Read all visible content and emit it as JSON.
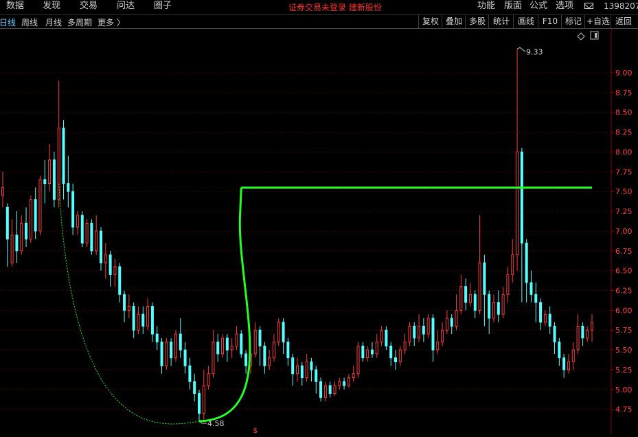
{
  "menu": {
    "items": [
      "数据",
      "发现",
      "交易",
      "问达",
      "圈子"
    ],
    "right_items": [
      "功能",
      "版面",
      "公式",
      "选项"
    ],
    "user_id": "1398207"
  },
  "status_text": "证券交易未登录  建新股份",
  "toolbar": {
    "periods": [
      "日线",
      "周线",
      "月线",
      "多周期",
      "更多 〉"
    ],
    "active_period": "日线",
    "buttons": [
      "复权",
      "叠加",
      "多股",
      "统计",
      "画线",
      "F10",
      "标记",
      "+自选",
      "返回"
    ]
  },
  "colors": {
    "up": "#ff3b3b",
    "down": "#54ffff",
    "grid": "#7a0000",
    "axis_label": "#ff4040",
    "cup_line": "#22ff22"
  },
  "chart_data": {
    "type": "candlestick",
    "ylim": [
      4.6,
      9.45
    ],
    "y_ticks": [
      "4.75",
      "5.00",
      "5.25",
      "5.50",
      "5.75",
      "6.00",
      "6.25",
      "6.50",
      "6.75",
      "7.00",
      "7.25",
      "7.50",
      "7.75",
      "8.00",
      "8.25",
      "8.50",
      "8.75",
      "9.00"
    ],
    "max_label": "9.33",
    "min_label": "4.58",
    "bottom_marker": "$",
    "resistance_level": 7.55,
    "candles": [
      [
        7.45,
        7.55,
        7.75,
        7.3
      ],
      [
        7.3,
        6.9,
        7.35,
        6.55
      ],
      [
        6.6,
        6.95,
        7.15,
        6.55
      ],
      [
        6.95,
        6.75,
        7.25,
        6.6
      ],
      [
        6.75,
        7.1,
        7.2,
        6.7
      ],
      [
        7.1,
        6.9,
        7.3,
        6.8
      ],
      [
        6.9,
        7.4,
        7.45,
        6.85
      ],
      [
        7.4,
        7.0,
        7.55,
        6.9
      ],
      [
        7.0,
        7.65,
        7.7,
        6.95
      ],
      [
        7.65,
        7.6,
        7.9,
        7.35
      ],
      [
        7.6,
        7.9,
        8.1,
        7.5
      ],
      [
        7.9,
        7.4,
        8.0,
        7.3
      ],
      [
        7.4,
        8.3,
        8.9,
        7.3
      ],
      [
        8.3,
        7.6,
        8.4,
        7.4
      ],
      [
        7.6,
        7.5,
        7.95,
        7.3
      ],
      [
        7.5,
        7.05,
        7.6,
        6.95
      ],
      [
        7.05,
        7.2,
        7.25,
        6.95
      ],
      [
        7.2,
        6.85,
        7.25,
        6.8
      ],
      [
        6.85,
        7.1,
        7.15,
        6.8
      ],
      [
        7.1,
        6.75,
        7.15,
        6.7
      ],
      [
        6.75,
        7.0,
        7.2,
        6.7
      ],
      [
        7.0,
        6.6,
        7.05,
        6.5
      ],
      [
        6.6,
        6.7,
        6.85,
        6.4
      ],
      [
        6.7,
        6.45,
        6.75,
        6.3
      ],
      [
        6.45,
        6.55,
        6.65,
        6.3
      ],
      [
        6.55,
        6.2,
        6.6,
        6.1
      ],
      [
        6.2,
        6.0,
        6.25,
        5.85
      ],
      [
        6.0,
        6.05,
        6.2,
        5.9
      ],
      [
        6.05,
        5.75,
        6.1,
        5.65
      ],
      [
        5.75,
        5.95,
        6.05,
        5.7
      ],
      [
        5.95,
        5.8,
        6.05,
        5.7
      ],
      [
        5.8,
        6.05,
        6.15,
        5.75
      ],
      [
        6.05,
        5.7,
        6.1,
        5.6
      ],
      [
        5.7,
        5.6,
        5.8,
        5.5
      ],
      [
        5.6,
        5.3,
        5.65,
        5.2
      ],
      [
        5.3,
        5.6,
        5.65,
        5.25
      ],
      [
        5.6,
        5.4,
        5.65,
        5.3
      ],
      [
        5.4,
        5.7,
        5.75,
        5.35
      ],
      [
        5.7,
        5.5,
        5.9,
        5.4
      ],
      [
        5.5,
        5.3,
        5.6,
        5.2
      ],
      [
        5.3,
        5.1,
        5.4,
        5.0
      ],
      [
        5.1,
        4.95,
        5.2,
        4.85
      ],
      [
        4.95,
        4.7,
        5.0,
        4.6
      ],
      [
        4.7,
        5.05,
        5.25,
        4.62
      ],
      [
        5.05,
        5.2,
        5.3,
        5.0
      ],
      [
        5.2,
        5.6,
        5.75,
        5.15
      ],
      [
        5.6,
        5.45,
        5.7,
        5.35
      ],
      [
        5.45,
        5.65,
        5.7,
        5.4
      ],
      [
        5.65,
        5.5,
        5.7,
        5.35
      ],
      [
        5.5,
        5.55,
        5.65,
        5.4
      ],
      [
        5.55,
        5.7,
        5.8,
        5.5
      ],
      [
        5.7,
        5.45,
        5.75,
        5.4
      ],
      [
        5.45,
        5.3,
        5.5,
        5.2
      ],
      [
        5.3,
        5.45,
        5.55,
        5.2
      ],
      [
        5.45,
        5.75,
        5.85,
        5.4
      ],
      [
        5.75,
        5.55,
        5.8,
        5.3
      ],
      [
        5.55,
        5.3,
        5.6,
        5.2
      ],
      [
        5.3,
        5.4,
        5.5,
        5.25
      ],
      [
        5.4,
        5.6,
        5.7,
        5.35
      ],
      [
        5.6,
        5.85,
        5.9,
        5.55
      ],
      [
        5.85,
        5.6,
        5.9,
        5.45
      ],
      [
        5.6,
        5.4,
        5.65,
        5.3
      ],
      [
        5.4,
        5.2,
        5.45,
        5.05
      ],
      [
        5.2,
        5.3,
        5.4,
        5.1
      ],
      [
        5.3,
        5.15,
        5.35,
        5.05
      ],
      [
        5.15,
        5.35,
        5.45,
        5.1
      ],
      [
        5.35,
        5.25,
        5.4,
        5.1
      ],
      [
        5.25,
        5.1,
        5.3,
        4.95
      ],
      [
        5.1,
        4.9,
        5.15,
        4.85
      ],
      [
        4.9,
        5.05,
        5.1,
        4.85
      ],
      [
        5.05,
        4.95,
        5.1,
        4.9
      ],
      [
        4.95,
        5.05,
        5.1,
        4.92
      ],
      [
        5.05,
        5.1,
        5.15,
        5.0
      ],
      [
        5.1,
        5.05,
        5.15,
        5.0
      ],
      [
        5.05,
        5.15,
        5.2,
        5.02
      ],
      [
        5.15,
        5.2,
        5.3,
        5.1
      ],
      [
        5.2,
        5.55,
        5.6,
        5.15
      ],
      [
        5.55,
        5.4,
        5.6,
        5.35
      ],
      [
        5.4,
        5.5,
        5.55,
        5.35
      ],
      [
        5.5,
        5.45,
        5.6,
        5.4
      ],
      [
        5.45,
        5.6,
        5.7,
        5.4
      ],
      [
        5.6,
        5.75,
        5.8,
        5.55
      ],
      [
        5.75,
        5.55,
        5.8,
        5.5
      ],
      [
        5.55,
        5.4,
        5.6,
        5.3
      ],
      [
        5.4,
        5.35,
        5.5,
        5.25
      ],
      [
        5.35,
        5.5,
        5.55,
        5.3
      ],
      [
        5.5,
        5.6,
        5.7,
        5.45
      ],
      [
        5.6,
        5.8,
        5.85,
        5.55
      ],
      [
        5.8,
        5.65,
        5.85,
        5.55
      ],
      [
        5.65,
        5.8,
        5.95,
        5.6
      ],
      [
        5.8,
        5.7,
        5.9,
        5.6
      ],
      [
        5.7,
        5.9,
        5.95,
        5.65
      ],
      [
        5.9,
        5.5,
        5.95,
        5.35
      ],
      [
        5.5,
        5.6,
        5.75,
        5.45
      ],
      [
        5.6,
        5.75,
        5.85,
        5.55
      ],
      [
        5.75,
        5.9,
        6.0,
        5.7
      ],
      [
        5.9,
        5.8,
        5.95,
        5.7
      ],
      [
        5.8,
        6.0,
        6.2,
        5.75
      ],
      [
        6.0,
        6.3,
        6.45,
        5.95
      ],
      [
        6.3,
        6.1,
        6.4,
        6.0
      ],
      [
        6.1,
        6.2,
        6.35,
        6.05
      ],
      [
        6.2,
        6.0,
        6.25,
        5.9
      ],
      [
        6.0,
        6.6,
        7.2,
        5.95
      ],
      [
        6.6,
        6.2,
        6.7,
        5.8
      ],
      [
        6.2,
        5.9,
        6.25,
        5.7
      ],
      [
        5.9,
        6.1,
        6.2,
        5.85
      ],
      [
        6.1,
        5.95,
        6.25,
        5.85
      ],
      [
        5.95,
        6.2,
        6.3,
        5.9
      ],
      [
        6.2,
        6.45,
        6.55,
        6.1
      ],
      [
        6.45,
        6.7,
        6.9,
        6.35
      ],
      [
        6.7,
        8.0,
        9.3,
        6.5
      ],
      [
        8.0,
        6.85,
        8.05,
        6.1
      ],
      [
        6.85,
        6.35,
        6.9,
        6.1
      ],
      [
        6.35,
        6.2,
        6.5,
        6.1
      ],
      [
        6.2,
        6.1,
        6.35,
        5.85
      ],
      [
        6.1,
        5.85,
        6.15,
        5.75
      ],
      [
        5.85,
        5.95,
        6.0,
        5.8
      ],
      [
        5.95,
        5.8,
        6.05,
        5.7
      ],
      [
        5.8,
        5.6,
        5.85,
        5.45
      ],
      [
        5.6,
        5.4,
        5.65,
        5.3
      ],
      [
        5.4,
        5.25,
        5.45,
        5.15
      ],
      [
        5.25,
        5.35,
        5.45,
        5.2
      ],
      [
        5.35,
        5.5,
        5.6,
        5.25
      ],
      [
        5.5,
        5.8,
        5.95,
        5.45
      ],
      [
        5.8,
        5.65,
        5.85,
        5.55
      ],
      [
        5.65,
        5.75,
        5.8,
        5.6
      ],
      [
        5.75,
        5.85,
        5.95,
        5.6
      ]
    ]
  }
}
